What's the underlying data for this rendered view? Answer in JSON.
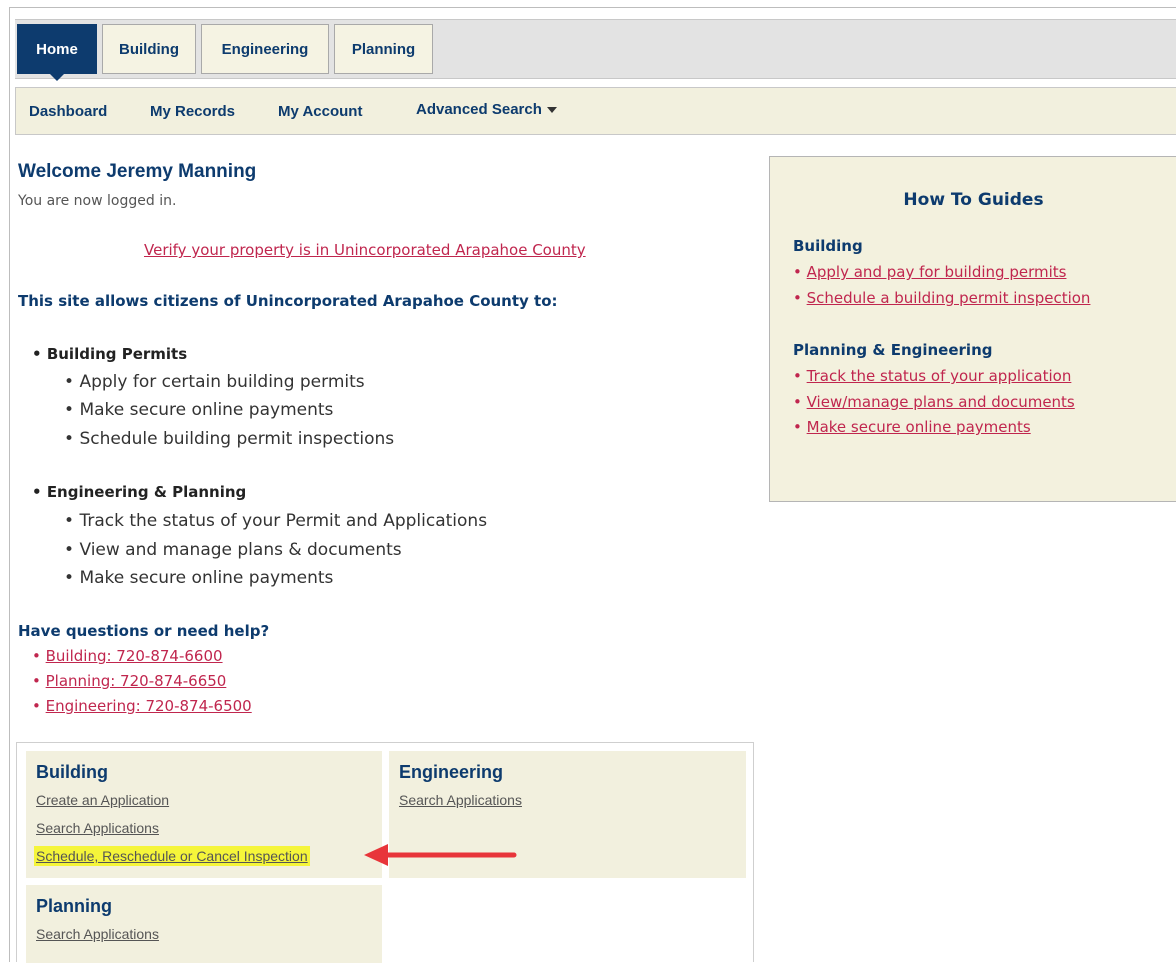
{
  "tabs": [
    {
      "label": "Home",
      "active": true
    },
    {
      "label": "Building",
      "active": false
    },
    {
      "label": "Engineering",
      "active": false
    },
    {
      "label": "Planning",
      "active": false
    }
  ],
  "subnav": {
    "dashboard": "Dashboard",
    "my_records": "My Records",
    "my_account": "My Account",
    "advanced_search": "Advanced Search"
  },
  "welcome": {
    "title": "Welcome Jeremy Manning",
    "status": "You are now logged in.",
    "verify_link": "Verify your property is in Unincorporated Arapahoe County",
    "intro": "This site allows citizens of Unincorporated Arapahoe County to:"
  },
  "features": [
    {
      "heading": "Building Permits",
      "items": [
        "Apply for certain building permits",
        "Make secure online payments",
        "Schedule building permit inspections"
      ]
    },
    {
      "heading": "Engineering & Planning",
      "items": [
        "Track the status of your Permit and Applications",
        "View and manage plans & documents",
        "Make secure online payments"
      ]
    }
  ],
  "help": {
    "heading": "Have questions or need help?",
    "links": [
      "Building: 720-874-6600",
      "Planning: 720-874-6650",
      "Engineering: 720-874-6500"
    ]
  },
  "guides": {
    "title": "How To Guides",
    "sections": [
      {
        "heading": "Building",
        "links": [
          "Apply and pay for building permits",
          "Schedule a building permit inspection"
        ]
      },
      {
        "heading": "Planning & Engineering",
        "links": [
          "Track the status of your application",
          "View/manage plans and documents",
          "Make secure online payments"
        ]
      }
    ]
  },
  "modules": {
    "building": {
      "title": "Building",
      "links": [
        "Create an Application",
        "Search Applications",
        "Schedule, Reschedule or Cancel Inspection"
      ]
    },
    "engineering": {
      "title": "Engineering",
      "links": [
        "Search Applications"
      ]
    },
    "planning": {
      "title": "Planning",
      "links": [
        "Search Applications"
      ]
    }
  },
  "colors": {
    "primary": "#0d3b6e",
    "link": "#c0264e",
    "panel": "#f2f0de",
    "highlight": "#f5f53a",
    "arrow": "#e8353a"
  }
}
